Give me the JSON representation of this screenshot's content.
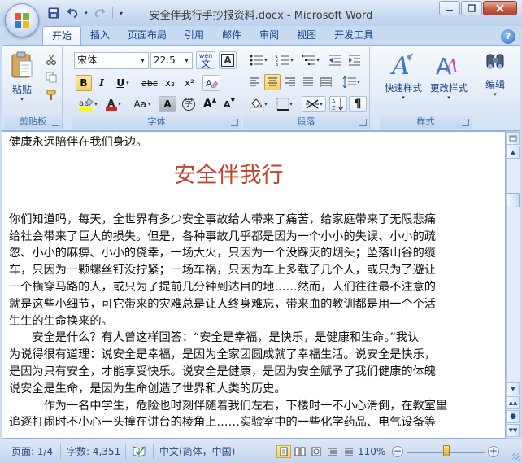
{
  "window": {
    "title": "安全伴我行手抄报资料.docx - Microsoft Word"
  },
  "tabs": [
    "开始",
    "插入",
    "页面布局",
    "引用",
    "邮件",
    "审阅",
    "视图",
    "开发工具"
  ],
  "ribbon": {
    "clipboard": {
      "label": "剪贴板",
      "paste_label": "粘贴"
    },
    "font": {
      "label": "字体",
      "font_name": "宋体",
      "font_size": "22.5",
      "wen_label": "wén",
      "bold": "B",
      "italic": "I",
      "underline": "U",
      "strike": "abc",
      "subscript": "x₂",
      "superscript": "x²",
      "change_case": "Aa",
      "char_shade": "A",
      "enclose": "字",
      "grow": "A",
      "shrink": "A",
      "font_color": "#e0201b",
      "highlight_color": "#ffff00"
    },
    "paragraph": {
      "label": "段落"
    },
    "styles": {
      "label": "样式",
      "quick_styles_label": "快速样式",
      "change_styles_label": "更改样式"
    },
    "editing": {
      "label": "编辑"
    }
  },
  "document": {
    "first_line": "健康永远陪伴在我们身边。",
    "title": "安全伴我行",
    "paragraphs": [
      "你们知道吗，每天，全世界有多少安全事故给人带来了痛苦，给家庭带来了无限悲痛",
      "给社会带来了巨大的损失。但是，各种事故几乎都是因为一个小小的失误、小小的疏",
      "忽、小小的麻痹、小小的侥幸，一场大火，只因为一个没踩灭的烟头；坠落山谷的缆",
      "车，只因为一颗螺丝钉没拧紧；一场车祸，只因为车上多载了几个人，或只为了避让",
      "一个横穿马路的人，或只为了提前几分钟到达目的地……然而，人们往往最不注意的",
      "就是这些小细节，可它带来的灾难总是让人终身难忘，带来血的教训都是用一个个活",
      "生生的生命换来的。",
      "　　安全是什么？有人曾这样回答：“安全是幸福，是快乐，是健康和生命。”我认",
      "为说得很有道理：说安全是幸福，是因为全家团圆成就了幸福生活。说安全是快乐，",
      "是因为只有安全，才能享受快乐。说安全是健康，是因为安全赋予了我们健康的体魄",
      "说安全是生命，是因为生命创造了世界和人类的历史。",
      "　　　作为一名中学生，危险也时刻伴随着我们左右，下楼时一不小心滑倒，在教室里",
      "追逐打闹时不小心一头撞在讲台的棱角上……实验室中的一些化学药品、电气设备等"
    ]
  },
  "statusbar": {
    "page": "页面: 1/4",
    "words": "字数: 4,351",
    "language": "中文(简体，中国)",
    "zoom": "110%",
    "zoom_level_percent": 110
  },
  "colors": {
    "accent": "#15428b",
    "title_red": "#c2432b"
  }
}
